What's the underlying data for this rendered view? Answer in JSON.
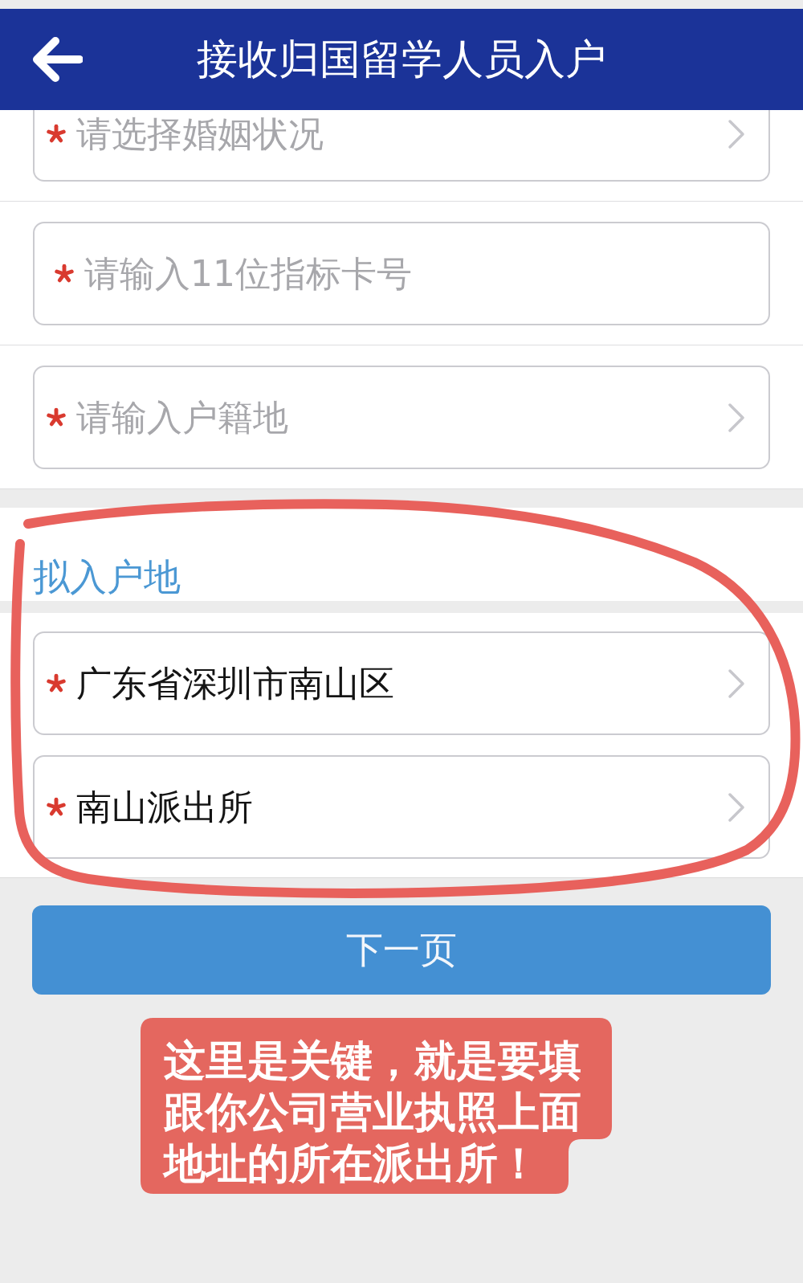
{
  "header": {
    "title": "接收归国留学人员入户"
  },
  "fields": [
    {
      "kind": "select",
      "required": true,
      "placeholder": "请选择婚姻状况"
    },
    {
      "kind": "text",
      "required": true,
      "placeholder": "请输入11位指标卡号"
    },
    {
      "kind": "select",
      "required": true,
      "placeholder": "请输入户籍地"
    }
  ],
  "destination": {
    "title": "拟入户地",
    "fields": [
      {
        "kind": "select",
        "required": true,
        "value": "广东省深圳市南山区"
      },
      {
        "kind": "select",
        "required": true,
        "value": "南山派出所"
      }
    ]
  },
  "next_button": {
    "label": "下一页"
  },
  "annotation": {
    "note": "这里是关键，就是要填跟你公司营业执照上面地址的所在派出所！"
  }
}
